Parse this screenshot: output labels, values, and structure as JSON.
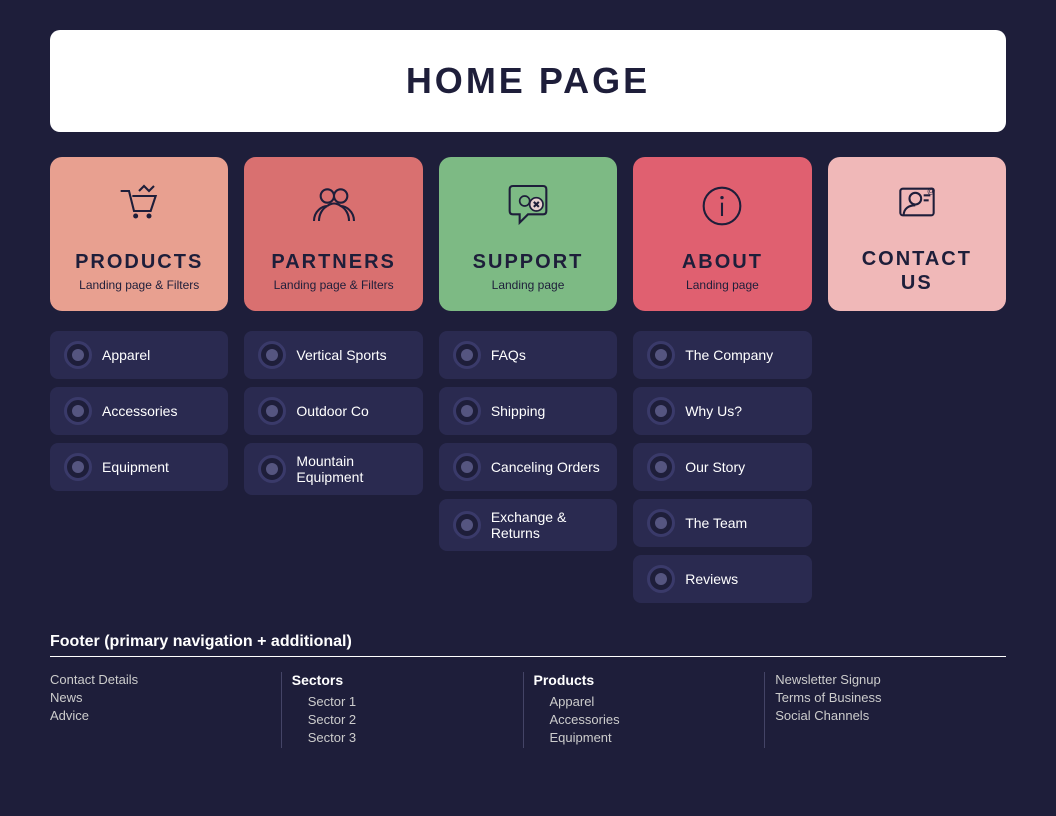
{
  "header": {
    "title": "HOME PAGE"
  },
  "cards": [
    {
      "id": "products",
      "title": "PRODUCTS",
      "subtitle": "Landing page & Filters",
      "colorClass": "card-products",
      "icon": "cart"
    },
    {
      "id": "partners",
      "title": "PARTNERS",
      "subtitle": "Landing page & Filters",
      "colorClass": "card-partners",
      "icon": "people"
    },
    {
      "id": "support",
      "title": "SUPPORT",
      "subtitle": "Landing page",
      "colorClass": "card-support",
      "icon": "chat"
    },
    {
      "id": "about",
      "title": "ABOUT",
      "subtitle": "Landing page",
      "colorClass": "card-about",
      "icon": "info"
    },
    {
      "id": "contact",
      "title": "CONTACT US",
      "subtitle": "",
      "colorClass": "card-contact",
      "icon": "contact"
    }
  ],
  "lists": [
    {
      "col": "products",
      "items": [
        "Apparel",
        "Accessories",
        "Equipment"
      ]
    },
    {
      "col": "partners",
      "items": [
        "Vertical Sports",
        "Outdoor Co",
        "Mountain Equipment"
      ]
    },
    {
      "col": "support",
      "items": [
        "FAQs",
        "Shipping",
        "Canceling Orders",
        "Exchange & Returns"
      ]
    },
    {
      "col": "about",
      "items": [
        "The Company",
        "Why Us?",
        "Our Story",
        "The Team",
        "Reviews"
      ]
    },
    {
      "col": "contact",
      "items": []
    }
  ],
  "footer": {
    "label": "Footer (primary navigation + additional)",
    "cols": [
      {
        "title": "",
        "items": [
          "Contact Details",
          "News",
          "Advice"
        ]
      },
      {
        "title": "Sectors",
        "items": [
          "Sector 1",
          "Sector 2",
          "Sector 3"
        ]
      },
      {
        "title": "Products",
        "items": [
          "Apparel",
          "Accessories",
          "Equipment"
        ]
      },
      {
        "title": "",
        "items": [
          "Newsletter Signup",
          "Terms of Business",
          "Social Channels"
        ]
      }
    ]
  }
}
